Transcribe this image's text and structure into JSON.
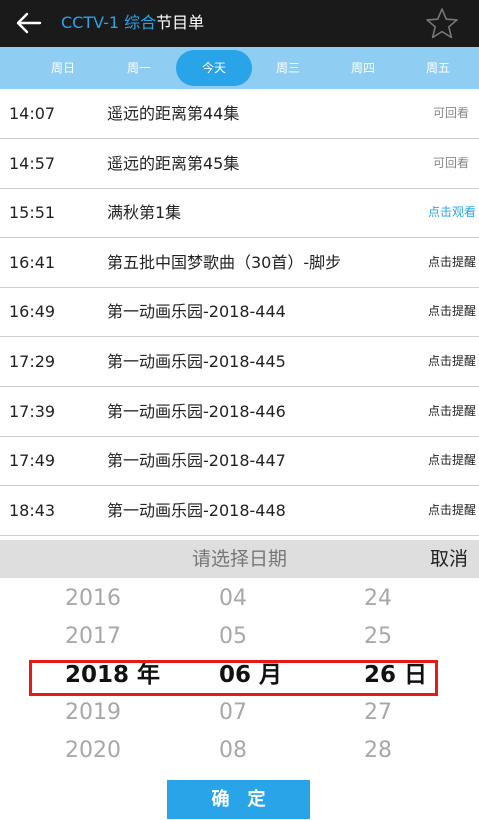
{
  "header": {
    "title_channel": "CCTV-1 综合",
    "title_suffix": "节目单"
  },
  "days": [
    "周日",
    "周一",
    "今天",
    "周三",
    "周四",
    "周五"
  ],
  "active_day": 2,
  "programs": [
    {
      "time": "14:07",
      "name": "遥远的距离第44集",
      "action": "可回看",
      "kind": "replay"
    },
    {
      "time": "14:57",
      "name": "遥远的距离第45集",
      "action": "可回看",
      "kind": "replay"
    },
    {
      "time": "15:51",
      "name": "满秋第1集",
      "action": "点击观看",
      "kind": "watch"
    },
    {
      "time": "16:41",
      "name": "第五批中国梦歌曲（30首）-脚步",
      "action": "点击提醒",
      "kind": "remind"
    },
    {
      "time": "16:49",
      "name": "第一动画乐园-2018-444",
      "action": "点击提醒",
      "kind": "remind"
    },
    {
      "time": "17:29",
      "name": "第一动画乐园-2018-445",
      "action": "点击提醒",
      "kind": "remind"
    },
    {
      "time": "17:39",
      "name": "第一动画乐园-2018-446",
      "action": "点击提醒",
      "kind": "remind"
    },
    {
      "time": "17:49",
      "name": "第一动画乐园-2018-447",
      "action": "点击提醒",
      "kind": "remind"
    },
    {
      "time": "18:43",
      "name": "第一动画乐园-2018-448",
      "action": "点击提醒",
      "kind": "remind"
    }
  ],
  "picker": {
    "title": "请选择日期",
    "cancel": "取消",
    "confirm": "确定",
    "years": [
      "2016",
      "2017",
      "2018 年",
      "2019",
      "2020"
    ],
    "months": [
      "04",
      "05",
      "06 月",
      "07",
      "08"
    ],
    "dates": [
      "24",
      "25",
      "26 日",
      "27",
      "28"
    ],
    "selected_index": 2
  },
  "colors": {
    "accent": "#2aa4e9",
    "day_bar": "#8fcdf2",
    "highlight_box": "#e41a1a"
  }
}
